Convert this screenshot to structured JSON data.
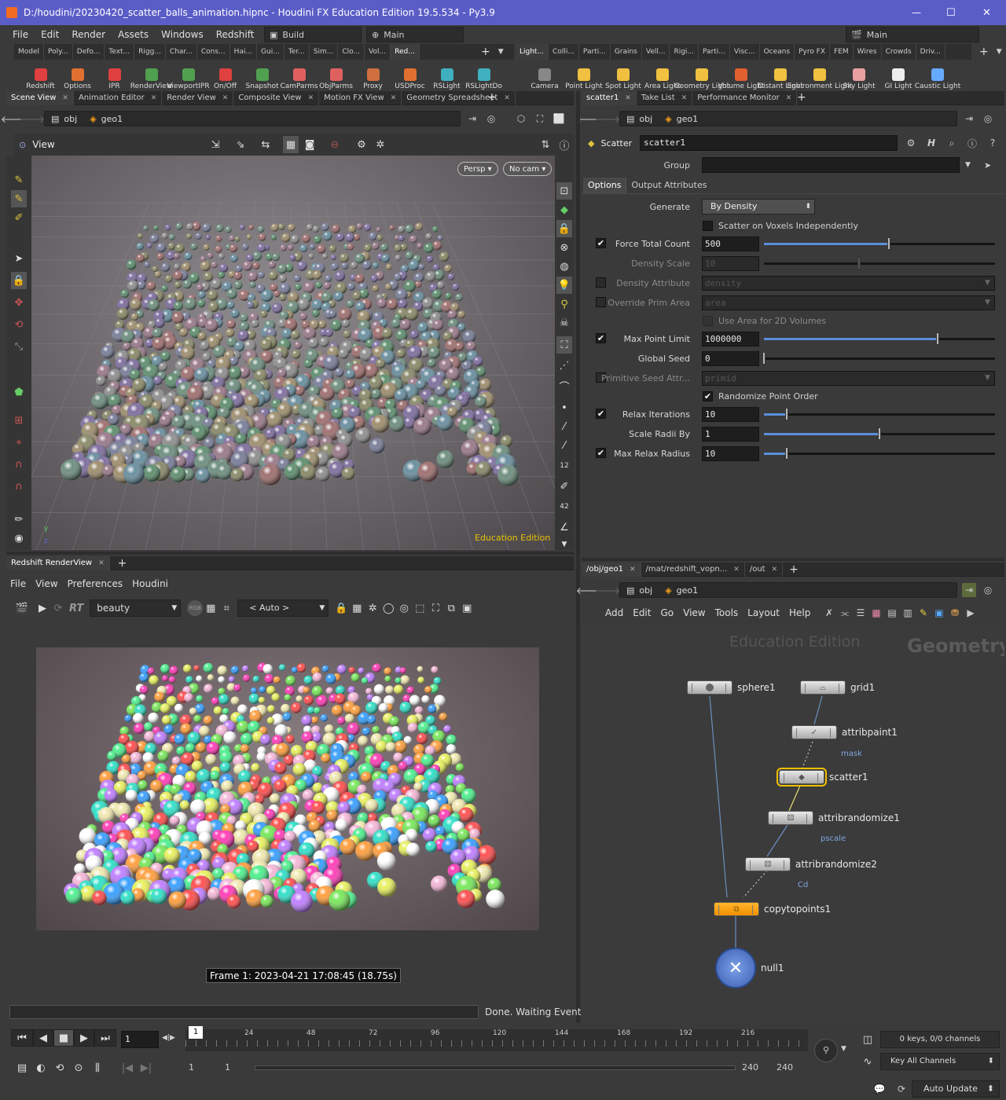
{
  "window": {
    "title": "D:/houdini/20230420_scatter_balls_animation.hipnc - Houdini FX Education Edition 19.5.534 - Py3.9",
    "minimize": "—",
    "maximize": "☐",
    "close": "✕"
  },
  "menubar": {
    "items": [
      "File",
      "Edit",
      "Render",
      "Assets",
      "Windows",
      "Redshift",
      "Help"
    ],
    "desktop_left": "Build",
    "desktop_right": "Main",
    "desktop_main": "Main"
  },
  "shelf_left": {
    "tabs": [
      "Model",
      "Poly...",
      "Defo...",
      "Text...",
      "Rigg...",
      "Char...",
      "Cons...",
      "Hai...",
      "Gui...",
      "Ter...",
      "Sim...",
      "Clo...",
      "Vol...",
      "Red..."
    ],
    "tools": [
      "Redshift",
      "Options",
      "IPR",
      "RenderView",
      "ViewportIPR",
      "On/Off",
      "Snapshot",
      "CamParms",
      "ObjParms",
      "Proxy",
      "USDProc",
      "RSLight",
      "RSLightDo"
    ]
  },
  "shelf_right": {
    "tabs": [
      "Light...",
      "Colli...",
      "Parti...",
      "Grains",
      "Vell...",
      "Rigi...",
      "Parti...",
      "Visc...",
      "Oceans",
      "Pyro FX",
      "FEM",
      "Wires",
      "Crowds",
      "Driv..."
    ],
    "tools": [
      "Camera",
      "Point Light",
      "Spot Light",
      "Area Light",
      "Geometry Light",
      "Volume Light",
      "Distant Light",
      "Environment Light",
      "Sky Light",
      "GI Light",
      "Caustic Light"
    ]
  },
  "scene_pane": {
    "tabs": [
      "Scene View",
      "Animation Editor",
      "Render View",
      "Composite View",
      "Motion FX View",
      "Geometry Spreadsheet"
    ],
    "path": [
      "obj",
      "geo1"
    ],
    "view_label": "View",
    "persp": "Persp ▾",
    "cam": "No cam ▾",
    "watermark": "Education Edition",
    "axis_y": "y",
    "axis_z": "z"
  },
  "param_pane": {
    "tabs": [
      "scatter1",
      "Take List",
      "Performance Monitor"
    ],
    "path": [
      "obj",
      "geo1"
    ],
    "node_type": "Scatter",
    "node_name": "scatter1",
    "group_label": "Group",
    "subtabs": [
      "Options",
      "Output Attributes"
    ],
    "generate_label": "Generate",
    "generate_value": "By Density",
    "scatter_voxels": "Scatter on Voxels Independently",
    "params": [
      {
        "label": "Force Total Count",
        "value": "500",
        "checked": true,
        "slider": 0.54,
        "disabled": false
      },
      {
        "label": "Density Scale",
        "value": "10",
        "checked": null,
        "slider": 0.41,
        "disabled": true
      },
      {
        "label": "Density Attribute",
        "value": "density",
        "checked": false,
        "slider": null,
        "disabled": true
      },
      {
        "label": "Override Prim Area",
        "value": "area",
        "checked": false,
        "slider": null,
        "disabled": true
      },
      {
        "label": "Max Point Limit",
        "value": "1000000",
        "checked": true,
        "slider": 0.75,
        "disabled": false
      },
      {
        "label": "Global Seed",
        "value": "0",
        "checked": null,
        "slider": 0.0,
        "disabled": false
      },
      {
        "label": "Primitive Seed Attr...",
        "value": "primid",
        "checked": false,
        "slider": null,
        "disabled": true
      },
      {
        "label": "Relax Iterations",
        "value": "10",
        "checked": true,
        "slider": 0.1,
        "disabled": false
      },
      {
        "label": "Scale Radii By",
        "value": "1",
        "checked": null,
        "slider": 0.5,
        "disabled": false
      },
      {
        "label": "Max Relax Radius",
        "value": "10",
        "checked": true,
        "slider": 0.1,
        "disabled": false
      }
    ],
    "use_area_2d": "Use Area for 2D Volumes",
    "randomize_order": "Randomize Point Order"
  },
  "renderview": {
    "tab": "Redshift RenderView",
    "menu": [
      "File",
      "View",
      "Preferences",
      "Houdini"
    ],
    "aov": "beauty",
    "auto": "< Auto >",
    "rt": "RT",
    "rgb": "RGB",
    "frame_info": "Frame 1: 2023-04-21 17:08:45 (18.75s)",
    "status": "Done. Waiting Events"
  },
  "network": {
    "tabs": [
      "/obj/geo1",
      "/mat/redshift_vopn...",
      "/out"
    ],
    "path": [
      "obj",
      "geo1"
    ],
    "menu": [
      "Add",
      "Edit",
      "Go",
      "View",
      "Tools",
      "Layout",
      "Help"
    ],
    "watermark": "Education Edition",
    "context": "Geometry",
    "nodes": [
      {
        "name": "sphere1",
        "sub": ""
      },
      {
        "name": "grid1",
        "sub": ""
      },
      {
        "name": "attribpaint1",
        "sub": "mask"
      },
      {
        "name": "scatter1",
        "sub": ""
      },
      {
        "name": "attribrandomize1",
        "sub": "pscale"
      },
      {
        "name": "attribrandomize2",
        "sub": "Cd"
      },
      {
        "name": "copytopoints1",
        "sub": ""
      },
      {
        "name": "null1",
        "sub": ""
      }
    ]
  },
  "timeline": {
    "frame": "1",
    "marker": "1",
    "ticks": [
      "24",
      "48",
      "72",
      "96",
      "120",
      "144",
      "168",
      "192",
      "216"
    ],
    "keys": "0 keys, 0/0 channels",
    "key_all": "Key All Channels",
    "start": "1",
    "start2": "1",
    "end": "240",
    "end2": "240",
    "auto_update": "Auto Update"
  }
}
